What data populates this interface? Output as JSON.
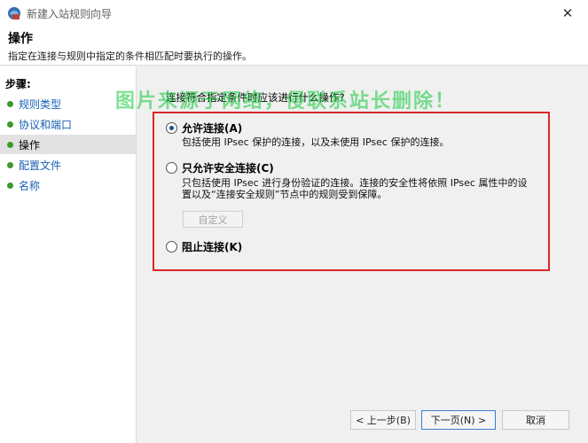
{
  "window": {
    "title": "新建入站规则向导",
    "close_glyph": "✕"
  },
  "header": {
    "title": "操作",
    "description": "指定在连接与规则中指定的条件相匹配时要执行的操作。"
  },
  "sidebar": {
    "heading": "步骤:",
    "items": [
      {
        "label": "规则类型",
        "active": false
      },
      {
        "label": "协议和端口",
        "active": false
      },
      {
        "label": "操作",
        "active": true
      },
      {
        "label": "配置文件",
        "active": false
      },
      {
        "label": "名称",
        "active": false
      }
    ]
  },
  "main": {
    "question": "连接符合指定条件时应该进行什么操作?",
    "watermark": "图片来源于网络，侵联系站长删除！",
    "options": [
      {
        "label": "允许连接(A)",
        "checked": true,
        "description": "包括使用 IPsec 保护的连接，以及未使用 IPsec 保护的连接。"
      },
      {
        "label": "只允许安全连接(C)",
        "checked": false,
        "description_line1": "只包括使用 IPsec 进行身份验证的连接。连接的安全性将依照 IPsec 属性中的设",
        "description_line2": "置以及“连接安全规则”节点中的规则受到保障。"
      },
      {
        "label": "阻止连接(K)",
        "checked": false
      }
    ],
    "custom_button": "自定义"
  },
  "footer": {
    "back": "< 上一步(B)",
    "next": "下一页(N) >",
    "cancel": "取消"
  },
  "colors": {
    "highlight_border": "#d62828",
    "step_dot": "#3b9b2a",
    "link": "#1a5fb4",
    "watermark": "#14c83c"
  }
}
